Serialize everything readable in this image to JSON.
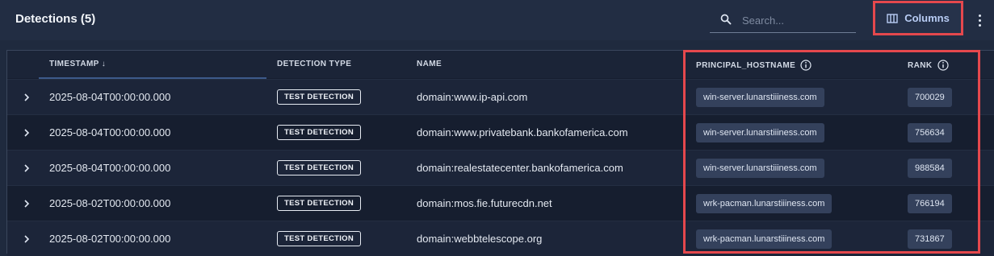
{
  "header": {
    "title": "Detections (5)",
    "search_placeholder": "Search...",
    "columns_label": "Columns"
  },
  "table": {
    "columns": {
      "timestamp": "TIMESTAMP ↓",
      "detection_type": "DETECTION TYPE",
      "name": "NAME",
      "principal_hostname": "PRINCIPAL_HOSTNAME",
      "rank": "RANK"
    },
    "rows": [
      {
        "timestamp": "2025-08-04T00:00:00.000",
        "type": "TEST DETECTION",
        "name": "domain:www.ip-api.com",
        "hostname": "win-server.lunarstiiiness.com",
        "rank": "700029"
      },
      {
        "timestamp": "2025-08-04T00:00:00.000",
        "type": "TEST DETECTION",
        "name": "domain:www.privatebank.bankofamerica.com",
        "hostname": "win-server.lunarstiiiness.com",
        "rank": "756634"
      },
      {
        "timestamp": "2025-08-04T00:00:00.000",
        "type": "TEST DETECTION",
        "name": "domain:realestatecenter.bankofamerica.com",
        "hostname": "win-server.lunarstiiiness.com",
        "rank": "988584"
      },
      {
        "timestamp": "2025-08-02T00:00:00.000",
        "type": "TEST DETECTION",
        "name": "domain:mos.fie.futurecdn.net",
        "hostname": "wrk-pacman.lunarstiiiness.com",
        "rank": "766194"
      },
      {
        "timestamp": "2025-08-02T00:00:00.000",
        "type": "TEST DETECTION",
        "name": "domain:webbtelescope.org",
        "hostname": "wrk-pacman.lunarstiiiness.com",
        "rank": "731867"
      }
    ]
  }
}
